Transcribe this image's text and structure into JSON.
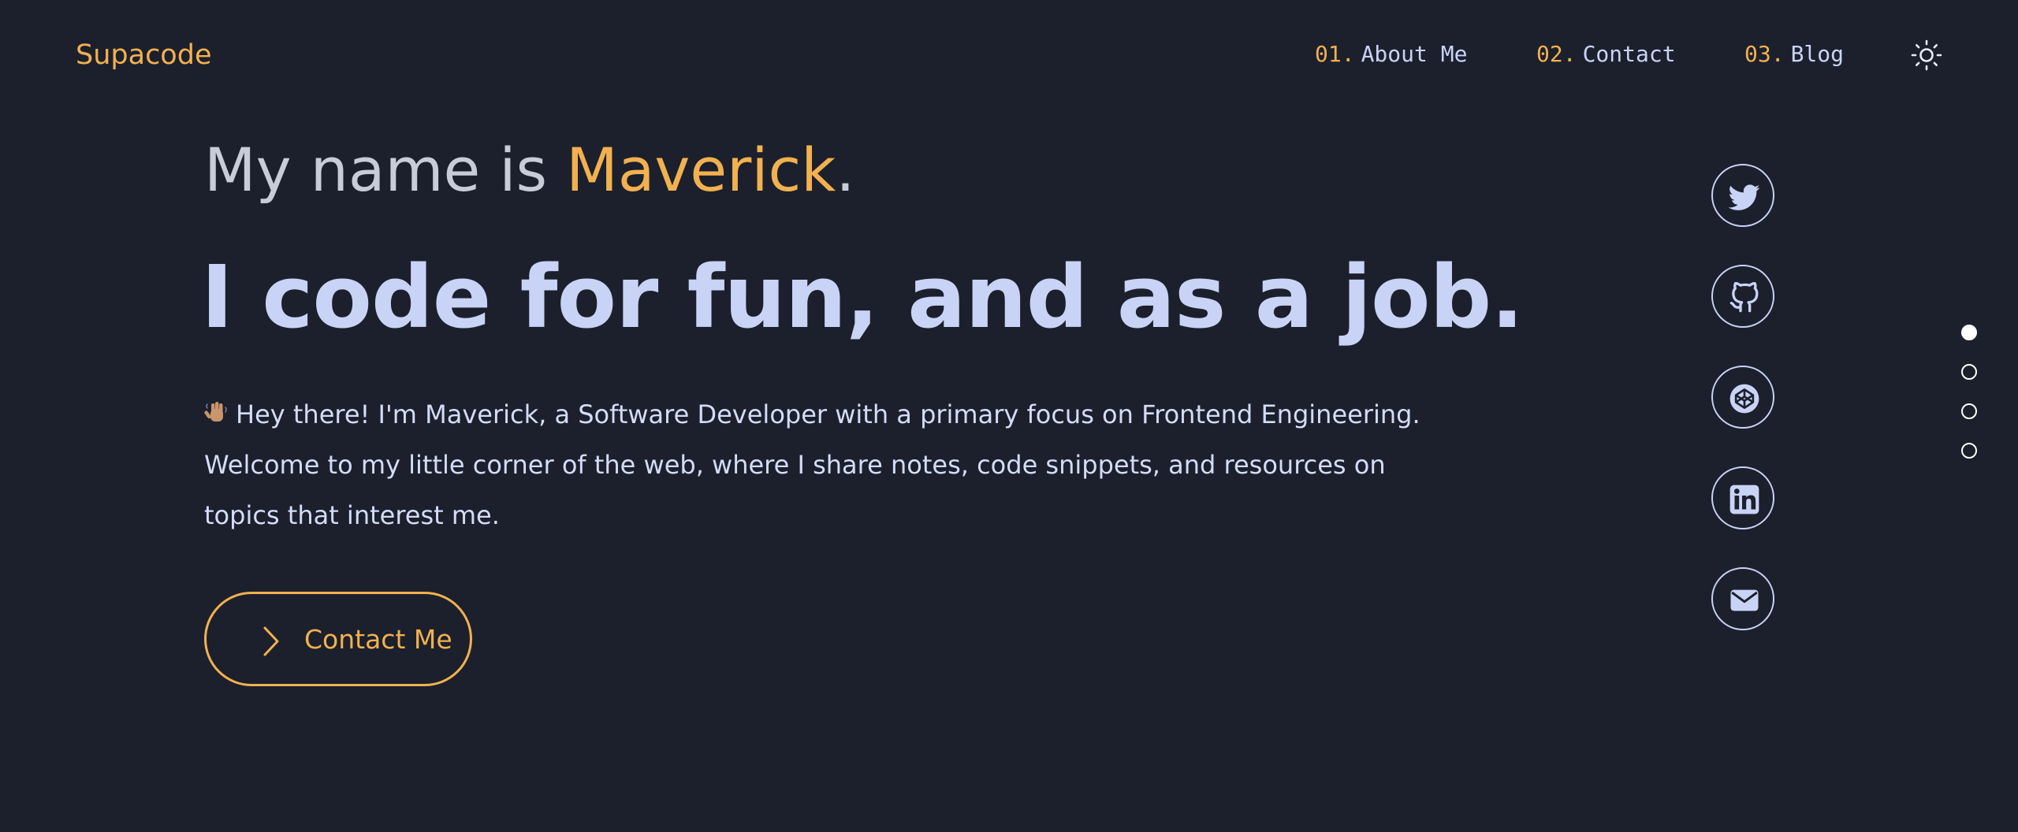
{
  "brand": {
    "logo": "Supacode",
    "accent_color": "#f2b14f",
    "background": "#1c202d"
  },
  "nav": {
    "items": [
      {
        "num": "01.",
        "label": "About Me"
      },
      {
        "num": "02.",
        "label": "Contact"
      },
      {
        "num": "03.",
        "label": "Blog"
      }
    ],
    "theme_toggle_icon": "sun-icon"
  },
  "hero": {
    "intro_prefix": "My name is ",
    "intro_name": "Maverick",
    "intro_suffix": ".",
    "headline": "I code for fun, and as a job.",
    "bio_emoji_icon": "waving-hand-icon",
    "bio": "Hey there! I'm Maverick, a Software Developer with a primary focus on Frontend Engineering. Welcome to my little corner of the web, where I share notes, code snippets, and resources on topics that interest me.",
    "cta_label": "Contact Me",
    "cta_icon": "chevron-right-icon"
  },
  "social": {
    "icons": [
      "twitter-icon",
      "github-icon",
      "codepen-icon",
      "linkedin-icon",
      "mail-icon"
    ]
  },
  "section_nav": {
    "count": 4,
    "active_index": 0
  }
}
